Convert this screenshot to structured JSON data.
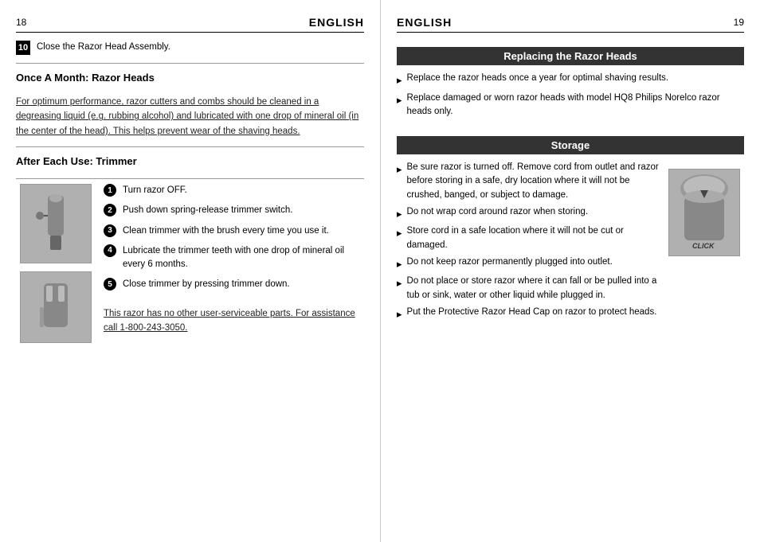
{
  "left": {
    "page_number": "18",
    "page_title": "ENGLISH",
    "step10": {
      "number": "10",
      "text": "Close the Razor Head Assembly."
    },
    "section1_title": "Once A Month:  Razor Heads",
    "section1_body": "For optimum performance, razor cutters and combs should be cleaned in a degreasing liquid (e.g. rubbing alcohol) and lubricated with one drop of mineral oil (in the center of the head). This helps prevent wear of the shaving heads.",
    "section2_title": "After Each Use:  Trimmer",
    "steps": [
      {
        "number": "1",
        "text": "Turn razor OFF."
      },
      {
        "number": "2",
        "text": "Push down spring-release trimmer switch."
      },
      {
        "number": "3",
        "text": "Clean trimmer with the brush every time you use it."
      },
      {
        "number": "4",
        "text": "Lubricate the trimmer teeth with one drop of mineral oil every 6 months."
      },
      {
        "number": "5",
        "text": "Close trimmer by pressing trimmer down."
      }
    ],
    "footer": "This razor has no other user-serviceable parts. For assistance call 1-800-243-3050."
  },
  "right": {
    "page_number": "19",
    "page_title": "ENGLISH",
    "section1_title": "Replacing the Razor Heads",
    "section1_bullets": [
      "Replace the razor heads once a year for optimal shaving results.",
      "Replace damaged or worn razor heads with model HQ8 Philips Norelco razor heads only."
    ],
    "section2_title": "Storage",
    "section2_bullets": [
      "Be sure razor is turned off. Remove cord from outlet and razor before storing in a safe, dry location where it will not be crushed, banged, or subject to damage.",
      "Do not wrap cord around razor when storing.",
      "Store cord in a safe location where it will not be cut or damaged.",
      "Do not keep razor permanently plugged into outlet.",
      "Do not place or store razor where it can fall or be pulled into a tub or sink, water or other liquid while plugged in.",
      "Put the Protective Razor Head Cap on razor to protect heads."
    ],
    "click_label": "CLICK"
  }
}
